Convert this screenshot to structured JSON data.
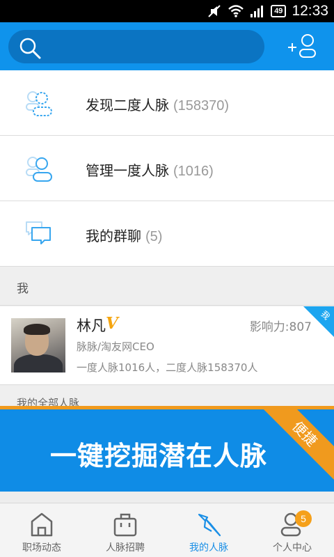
{
  "status_bar": {
    "time": "12:33",
    "battery": "49"
  },
  "search": {
    "placeholder": ""
  },
  "menu": [
    {
      "label": "发现二度人脉",
      "count": "(158370)",
      "icon": "second-degree-contacts-icon"
    },
    {
      "label": "管理一度人脉",
      "count": "(1016)",
      "icon": "first-degree-contacts-icon"
    },
    {
      "label": "我的群聊",
      "count": "(5)",
      "icon": "group-chat-icon"
    }
  ],
  "section_me": "我",
  "profile": {
    "name": "林凡",
    "vip": "V",
    "influence": "影响力:807",
    "title": "脉脉/淘友网CEO",
    "stats": "一度人脉1016人，二度人脉158370人",
    "corner": "我"
  },
  "all_contacts": "我的全部人脉",
  "banner": {
    "text": "一键挖掘潜在人脉",
    "ribbon": "便捷"
  },
  "tabs": [
    {
      "label": "职场动态",
      "icon": "home-icon"
    },
    {
      "label": "人脉招聘",
      "icon": "briefcase-icon"
    },
    {
      "label": "我的人脉",
      "icon": "tie-icon",
      "active": true
    },
    {
      "label": "个人中心",
      "icon": "profile-icon",
      "badge": "5"
    }
  ],
  "colors": {
    "primary": "#0f93ec",
    "accent": "#f09a1e",
    "active_tab": "#1a8fe6"
  }
}
